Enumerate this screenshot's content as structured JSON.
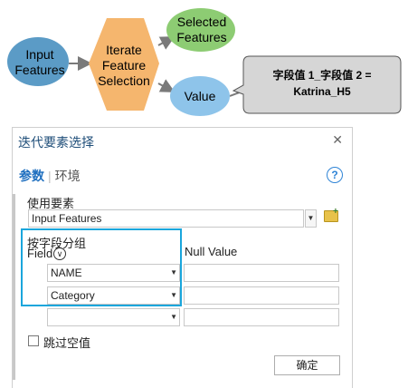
{
  "model": {
    "input_features": [
      "Input",
      "Features"
    ],
    "iterate": [
      "Iterate",
      "Feature",
      "Selection"
    ],
    "selected_features": [
      "Selected",
      "Features"
    ],
    "value": "Value",
    "callout": [
      "字段值 1_字段值 2 =",
      "Katrina_H5"
    ],
    "colors": {
      "input_node": "#5b9bc6",
      "tool_node": "#f5b66e",
      "selected_node": "#8dcc73",
      "value_node": "#8ec4ea",
      "callout_fill": "#d6d6d6",
      "arrow": "#7a7a7a"
    }
  },
  "pane": {
    "title": "迭代要素选择",
    "close_icon": "close-icon",
    "tabs": {
      "params": "参数",
      "separator": "|",
      "env": "环境"
    },
    "help_icon": "?",
    "input_label": "使用要素",
    "input_value": "Input Features",
    "group_label": "按字段分组",
    "field_header": "Field",
    "null_header": "Null Value",
    "rows": [
      {
        "field": "NAME",
        "null_value": ""
      },
      {
        "field": "Category",
        "null_value": ""
      },
      {
        "field": "",
        "null_value": ""
      }
    ],
    "skip_null_label": "跳过空值",
    "skip_null_checked": false,
    "ok_label": "确定",
    "highlight_color": "#1aa6dc"
  }
}
